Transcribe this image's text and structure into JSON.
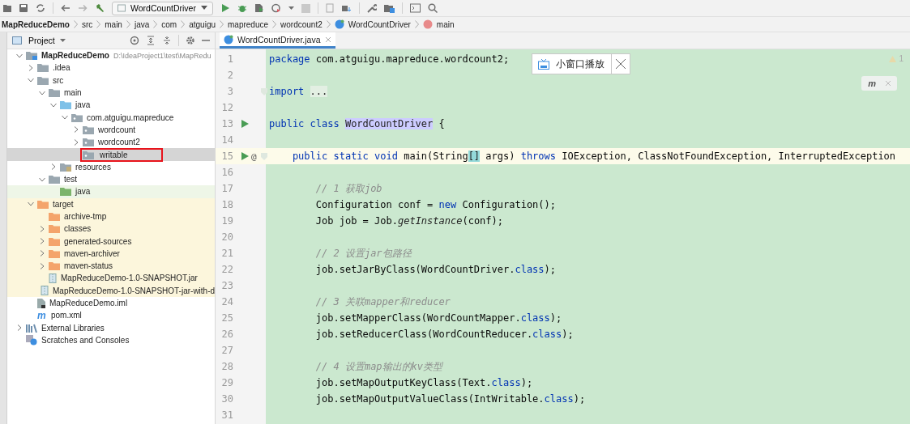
{
  "toolbar": {
    "run_config": "WordCountDriver"
  },
  "breadcrumbs": [
    {
      "label": "MapReduceDemo",
      "kind": "module"
    },
    {
      "label": "src",
      "kind": "folder"
    },
    {
      "label": "main",
      "kind": "folder"
    },
    {
      "label": "java",
      "kind": "folder"
    },
    {
      "label": "com",
      "kind": "folder"
    },
    {
      "label": "atguigu",
      "kind": "folder"
    },
    {
      "label": "mapreduce",
      "kind": "folder"
    },
    {
      "label": "wordcount2",
      "kind": "folder"
    },
    {
      "label": "WordCountDriver",
      "kind": "class"
    },
    {
      "label": "main",
      "kind": "method"
    }
  ],
  "project_panel": {
    "title": "Project"
  },
  "tree": [
    {
      "label": "MapReduceDemo",
      "path": "D:\\IdeaProject1\\test\\MapRedu",
      "kind": "module",
      "expanded": true,
      "selected": false,
      "children": [
        {
          "label": ".idea",
          "kind": "folder",
          "expanded": false,
          "selected": false
        },
        {
          "label": "src",
          "kind": "folder",
          "expanded": true,
          "selected": false,
          "children": [
            {
              "label": "main",
              "kind": "folder",
              "expanded": true,
              "selected": false,
              "children": [
                {
                  "label": "java",
                  "kind": "source",
                  "expanded": true,
                  "selected": false,
                  "children": [
                    {
                      "label": "com.atguigu.mapreduce",
                      "kind": "package",
                      "expanded": true,
                      "selected": false,
                      "children": [
                        {
                          "label": "wordcount",
                          "kind": "package",
                          "expanded": false,
                          "selected": false
                        },
                        {
                          "label": "wordcount2",
                          "kind": "package",
                          "expanded": false,
                          "selected": false
                        },
                        {
                          "label": "writable",
                          "kind": "package",
                          "selected": true,
                          "marked": true
                        }
                      ]
                    }
                  ]
                },
                {
                  "label": "resources",
                  "kind": "resources",
                  "expanded": false,
                  "selected": false
                }
              ]
            },
            {
              "label": "test",
              "kind": "folder",
              "expanded": true,
              "selected": false,
              "children": [
                {
                  "label": "java",
                  "kind": "test-source",
                  "selected": false
                }
              ]
            }
          ]
        },
        {
          "label": "target",
          "kind": "excluded",
          "expanded": true,
          "selected": false,
          "children": [
            {
              "label": "archive-tmp",
              "kind": "excluded",
              "selected": false
            },
            {
              "label": "classes",
              "kind": "excluded",
              "expanded": false,
              "selected": false
            },
            {
              "label": "generated-sources",
              "kind": "excluded",
              "expanded": false,
              "selected": false
            },
            {
              "label": "maven-archiver",
              "kind": "excluded",
              "expanded": false,
              "selected": false
            },
            {
              "label": "maven-status",
              "kind": "excluded",
              "expanded": false,
              "selected": false
            },
            {
              "label": "MapReduceDemo-1.0-SNAPSHOT.jar",
              "kind": "jar",
              "selected": false
            },
            {
              "label": "MapReduceDemo-1.0-SNAPSHOT-jar-with-d",
              "kind": "jar",
              "selected": false
            }
          ]
        },
        {
          "label": "MapReduceDemo.iml",
          "kind": "iml",
          "selected": false
        },
        {
          "label": "pom.xml",
          "kind": "maven",
          "icon": "m",
          "selected": false
        }
      ]
    },
    {
      "label": "External Libraries",
      "kind": "libraries",
      "expanded": false,
      "selected": false
    },
    {
      "label": "Scratches and Consoles",
      "kind": "scratches",
      "selected": false
    }
  ],
  "editor_tabs": [
    {
      "label": "WordCountDriver.java",
      "selected": true
    }
  ],
  "popup": {
    "label": "小窗口播放"
  },
  "inspections": {
    "warnings": "1"
  },
  "maven_reload": {
    "icon": "m"
  },
  "lines": [
    {
      "number": "1",
      "tokens": [
        {
          "kind": "keyword",
          "text": "package"
        },
        {
          "kind": "plain",
          "text": " com.atguigu.mapreduce.wordcount2;"
        }
      ]
    },
    {
      "number": "2"
    },
    {
      "number": "3",
      "gutter": [
        {
          "kind": "fold"
        }
      ],
      "tokens": [
        {
          "kind": "keyword",
          "text": "import"
        },
        {
          "kind": "folded",
          "text": "..."
        }
      ]
    },
    {
      "number": "12"
    },
    {
      "number": "13",
      "gutter": [
        {
          "kind": "run"
        }
      ],
      "tokens": [
        {
          "kind": "keyword",
          "text": "public class"
        },
        {
          "kind": "usage",
          "text": "WordCountDriver"
        },
        {
          "kind": "plain",
          "text": " {"
        }
      ],
      "children": [
        {
          "number": "14"
        },
        {
          "number": "15",
          "current": true,
          "gutter": [
            {
              "kind": "run"
            },
            {
              "kind": "implements",
              "glyph": "@"
            },
            {
              "kind": "fold"
            }
          ],
          "tokens": [
            {
              "kind": "keyword",
              "text": "public static void"
            },
            {
              "kind": "plain",
              "text": " main(String"
            },
            {
              "kind": "match",
              "text": "[]"
            },
            {
              "kind": "plain",
              "text": " args) "
            },
            {
              "kind": "keyword",
              "text": "throws"
            },
            {
              "kind": "plain",
              "text": " IOException, ClassNotFoundException, InterruptedException"
            }
          ],
          "children": [
            {
              "number": "16"
            },
            {
              "number": "17",
              "tokens": [
                {
                  "kind": "comment",
                  "text": "// 1 获取job"
                }
              ]
            },
            {
              "number": "18",
              "tokens": [
                {
                  "kind": "plain",
                  "text": "Configuration conf = "
                },
                {
                  "kind": "keyword",
                  "text": "new"
                },
                {
                  "kind": "plain",
                  "text": " Configuration();"
                }
              ]
            },
            {
              "number": "19",
              "tokens": [
                {
                  "kind": "plain",
                  "text": "Job job = Job."
                },
                {
                  "kind": "static",
                  "text": "getInstance"
                },
                {
                  "kind": "plain",
                  "text": "(conf);"
                }
              ]
            },
            {
              "number": "20"
            },
            {
              "number": "21",
              "tokens": [
                {
                  "kind": "comment",
                  "text": "// 2 设置jar包路径"
                }
              ]
            },
            {
              "number": "22",
              "tokens": [
                {
                  "kind": "plain",
                  "text": "job.setJarByClass(WordCountDriver."
                },
                {
                  "kind": "keyword",
                  "text": "class"
                },
                {
                  "kind": "plain",
                  "text": ");"
                }
              ]
            },
            {
              "number": "23"
            },
            {
              "number": "24",
              "tokens": [
                {
                  "kind": "comment",
                  "text": "// 3 关联mapper和reducer"
                }
              ]
            },
            {
              "number": "25",
              "tokens": [
                {
                  "kind": "plain",
                  "text": "job.setMapperClass(WordCountMapper."
                },
                {
                  "kind": "keyword",
                  "text": "class"
                },
                {
                  "kind": "plain",
                  "text": ");"
                }
              ]
            },
            {
              "number": "26",
              "tokens": [
                {
                  "kind": "plain",
                  "text": "job.setReducerClass(WordCountReducer."
                },
                {
                  "kind": "keyword",
                  "text": "class"
                },
                {
                  "kind": "plain",
                  "text": ");"
                }
              ]
            },
            {
              "number": "27"
            },
            {
              "number": "28",
              "tokens": [
                {
                  "kind": "comment",
                  "text": "// 4 设置map输出的kv类型"
                }
              ]
            },
            {
              "number": "29",
              "tokens": [
                {
                  "kind": "plain",
                  "text": "job.setMapOutputKeyClass(Text."
                },
                {
                  "kind": "keyword",
                  "text": "class"
                },
                {
                  "kind": "plain",
                  "text": ");"
                }
              ]
            },
            {
              "number": "30",
              "tokens": [
                {
                  "kind": "plain",
                  "text": "job.setMapOutputValueClass(IntWritable."
                },
                {
                  "kind": "keyword",
                  "text": "class"
                },
                {
                  "kind": "plain",
                  "text": ");"
                }
              ]
            },
            {
              "number": "31"
            }
          ]
        }
      ]
    }
  ]
}
